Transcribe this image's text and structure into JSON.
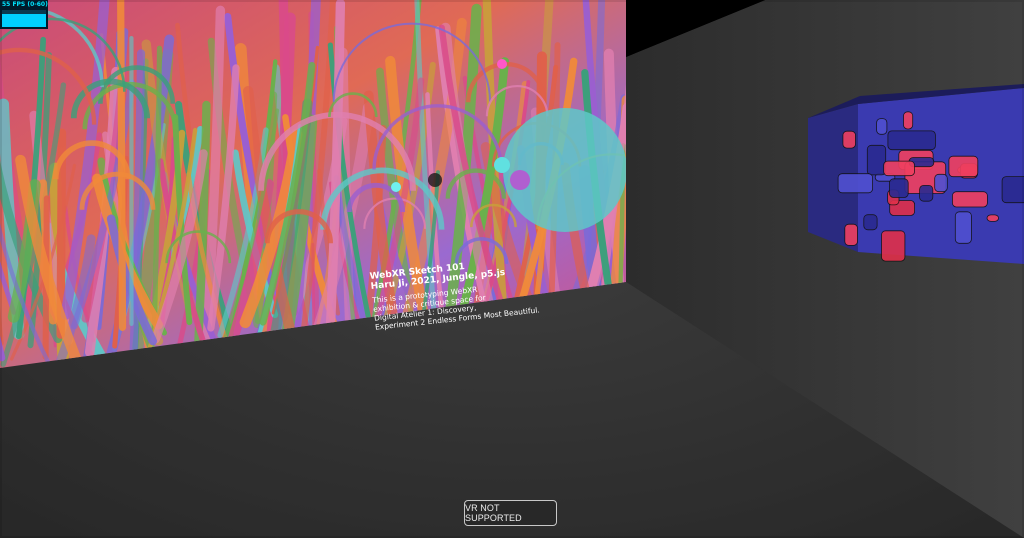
{
  "stats": {
    "fps_label": "55 FPS (0-60)"
  },
  "artwork": {
    "title": "WebXR Sketch 101",
    "credit": "Haru Ji, 2021, Jungle, p5.js",
    "description_lines": [
      "This is a prototyping WebXR",
      "exhibition & critique space for",
      "Digital Atelier 1: Discovery,",
      "Experiment 2 Endless Forms Most Beautiful."
    ]
  },
  "vr_button": {
    "label": "VR NOT SUPPORTED"
  },
  "colors": {
    "floor": "#2e2e2e",
    "ceiling": "#000000",
    "right_wall": "#3a3a3a",
    "painting_bg": "#e05a6a",
    "cube_blue": "#3a3aa0",
    "cube_red": "#e0304a"
  }
}
